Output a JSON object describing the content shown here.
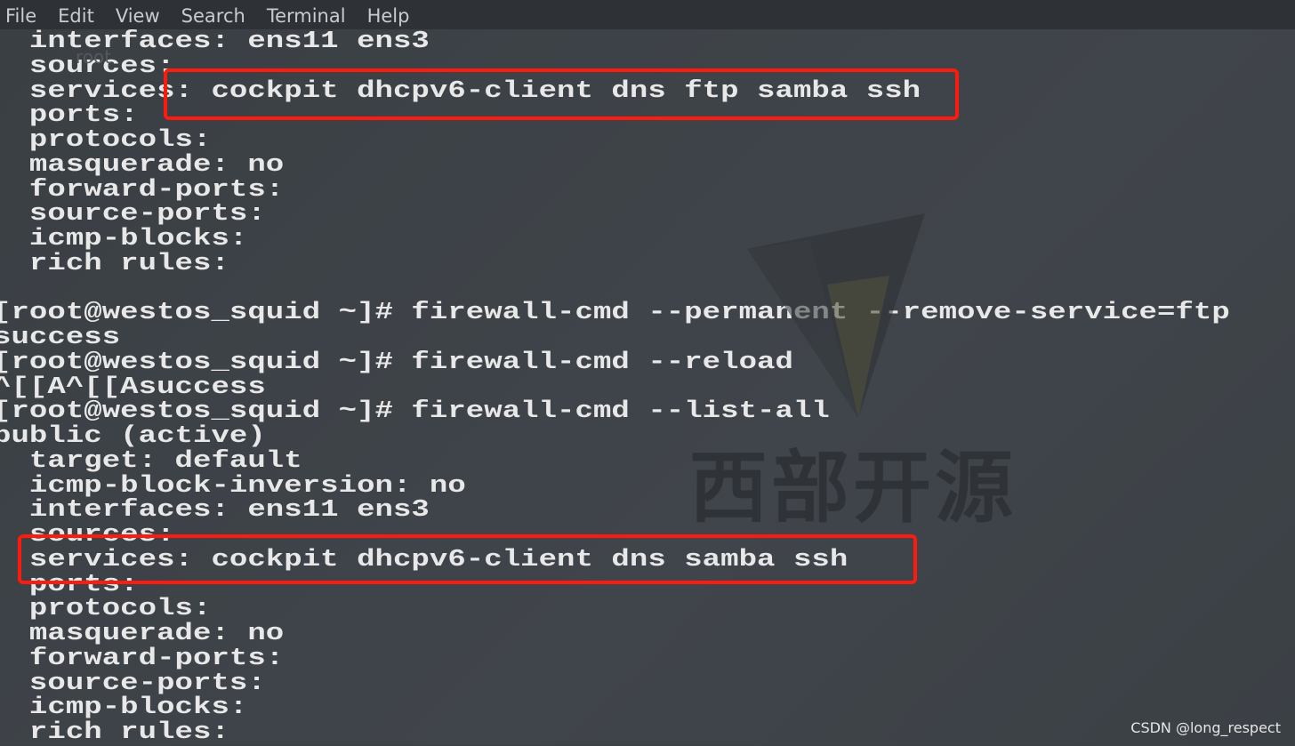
{
  "menu": [
    "File",
    "Edit",
    "View",
    "Search",
    "Terminal",
    "Help"
  ],
  "terminal_lines": [
    "  interfaces: ens11 ens3",
    "  sources:",
    "  services: cockpit dhcpv6-client dns ftp samba ssh",
    "  ports:",
    "  protocols:",
    "  masquerade: no",
    "  forward-ports:",
    "  source-ports:",
    "  icmp-blocks:",
    "  rich rules:",
    "",
    "[root@westos_squid ~]# firewall-cmd --permanent --remove-service=ftp",
    "success",
    "[root@westos_squid ~]# firewall-cmd --reload",
    "^[[A^[[Asuccess",
    "[root@westos_squid ~]# firewall-cmd --list-all",
    "public (active)",
    "  target: default",
    "  icmp-block-inversion: no",
    "  interfaces: ens11 ens3",
    "  sources:",
    "  services: cockpit dhcpv6-client dns samba ssh",
    "  ports:",
    "  protocols:",
    "  masquerade: no",
    "  forward-ports:",
    "  source-ports:",
    "  icmp-blocks:",
    "  rich rules:"
  ],
  "highlight_color": "#ff1a0e",
  "watermark_text": "西部开源",
  "desktop_ghost_text": "root",
  "credit": "CSDN @long_respect"
}
